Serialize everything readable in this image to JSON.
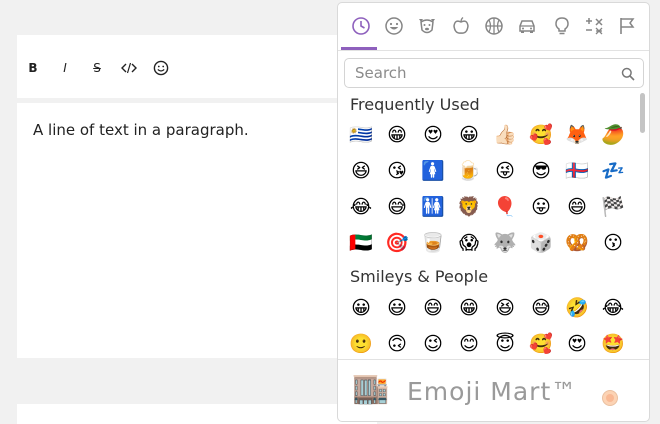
{
  "editor": {
    "paragraph": "A line of text in a paragraph."
  },
  "toolbar": {
    "bold_label": "B",
    "italic_label": "I",
    "strike_label": "S"
  },
  "picker": {
    "accent_color": "#8e60bd",
    "anchors": [
      "recent-icon",
      "smileys-icon",
      "animals-icon",
      "food-icon",
      "activity-icon",
      "travel-icon",
      "objects-icon",
      "symbols-icon",
      "flags-icon"
    ],
    "active_anchor": "recent-icon",
    "search": {
      "placeholder": "Search",
      "value": ""
    },
    "categories": [
      {
        "label": "Frequently Used",
        "emojis": [
          "🇺🇾",
          "😁",
          "😍",
          "😀",
          "👍🏻",
          "🥰",
          "🦊",
          "🥭",
          "😆",
          "😘",
          "🚺",
          "🍺",
          "😜",
          "😎",
          "🇫🇴",
          "💤",
          "😂",
          "😅",
          "🚻",
          "🦁",
          "🎈",
          "😛",
          "😄",
          "🏁",
          "🇦🇪",
          "🎯",
          "🥃",
          "😱",
          "🐺",
          "🎲",
          "🥨",
          "😗"
        ]
      },
      {
        "label": "Smileys & People",
        "emojis": [
          "😀",
          "😃",
          "😄",
          "😁",
          "😆",
          "😅",
          "🤣",
          "😂",
          "🙂",
          "🙃",
          "😉",
          "😊",
          "😇",
          "🥰",
          "😍",
          "🤩"
        ]
      }
    ],
    "preview": {
      "icon": "🏬",
      "title": "Emoji Mart™"
    }
  }
}
